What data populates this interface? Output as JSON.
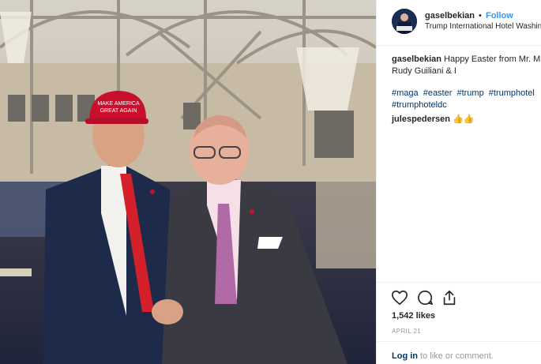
{
  "post": {
    "username": "gaselbekian",
    "separator": "•",
    "follow_label": "Follow",
    "location": "Trump International Hotel Washin",
    "caption": {
      "username": "gaselbekian",
      "line1": "Happy Easter from Mr. M",
      "line2": "Rudy Guiliani & I"
    },
    "hashtags": [
      "#maga",
      "#easter",
      "#trump",
      "#trumphotel",
      "#trumphoteldc"
    ],
    "comment": {
      "username": "julespedersen",
      "text": "👍👍"
    },
    "likes": "1,542 likes",
    "date": "APRIL 21",
    "login_link": "Log in",
    "login_rest": " to like or comment."
  },
  "icons": {
    "like": "heart-icon",
    "comment": "comment-icon",
    "share": "share-icon"
  },
  "photo": {
    "hat_text_line1": "MAKE AMERICA",
    "hat_text_line2": "GREAT AGAIN"
  },
  "colors": {
    "accent": "#3897f0",
    "hashtag": "#003569",
    "text": "#262626",
    "muted": "#999999",
    "divider": "#efefef"
  }
}
